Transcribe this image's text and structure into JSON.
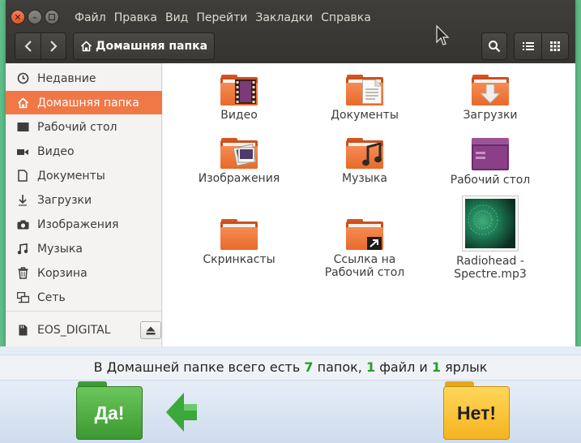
{
  "window": {
    "menu": [
      "Файл",
      "Правка",
      "Вид",
      "Перейти",
      "Закладки",
      "Справка"
    ],
    "path_label": "Домашняя папка"
  },
  "sidebar": {
    "items": [
      {
        "label": "Недавние",
        "icon": "clock-icon"
      },
      {
        "label": "Домашняя папка",
        "icon": "home-icon",
        "active": true
      },
      {
        "label": "Рабочий стол",
        "icon": "desktop-icon"
      },
      {
        "label": "Видео",
        "icon": "video-icon"
      },
      {
        "label": "Документы",
        "icon": "document-icon"
      },
      {
        "label": "Загрузки",
        "icon": "download-icon"
      },
      {
        "label": "Изображения",
        "icon": "camera-icon"
      },
      {
        "label": "Музыка",
        "icon": "music-icon"
      },
      {
        "label": "Корзина",
        "icon": "trash-icon"
      },
      {
        "label": "Сеть",
        "icon": "network-icon"
      }
    ],
    "device": {
      "label": "EOS_DIGITAL",
      "icon": "drive-icon"
    }
  },
  "files": [
    {
      "label": "Видео",
      "type": "folder",
      "emblem": "film-icon"
    },
    {
      "label": "Документы",
      "type": "folder",
      "emblem": "document-icon"
    },
    {
      "label": "Загрузки",
      "type": "folder",
      "emblem": "download-arrow-icon"
    },
    {
      "label": "Изображения",
      "type": "folder",
      "emblem": "picture-icon"
    },
    {
      "label": "Музыка",
      "type": "folder",
      "emblem": "music-note-icon"
    },
    {
      "label": "Рабочий стол",
      "type": "desktop-folder",
      "emblem": "desktop-icon"
    },
    {
      "label": "Скринкасты",
      "type": "folder",
      "emblem": ""
    },
    {
      "label": "Ссылка на Рабочий стол",
      "type": "folder-link",
      "emblem": "link-arrow-icon"
    },
    {
      "label": "Radiohead - Spectre.mp3",
      "type": "audio-file",
      "emblem": "album-art"
    }
  ],
  "question": {
    "prefix": "В Домашней папке всего есть",
    "folders_count": "7",
    "folders_word": "папок,",
    "files_count": "1",
    "files_word": "файл и",
    "links_count": "1",
    "links_word": "ярлык",
    "highlight_color": "#22a022"
  },
  "answers": {
    "yes": "Да!",
    "no": "Нет!"
  },
  "colors": {
    "accent": "#f07746",
    "titlebar": "#3c3b37",
    "folder": "#ec7b3d"
  }
}
